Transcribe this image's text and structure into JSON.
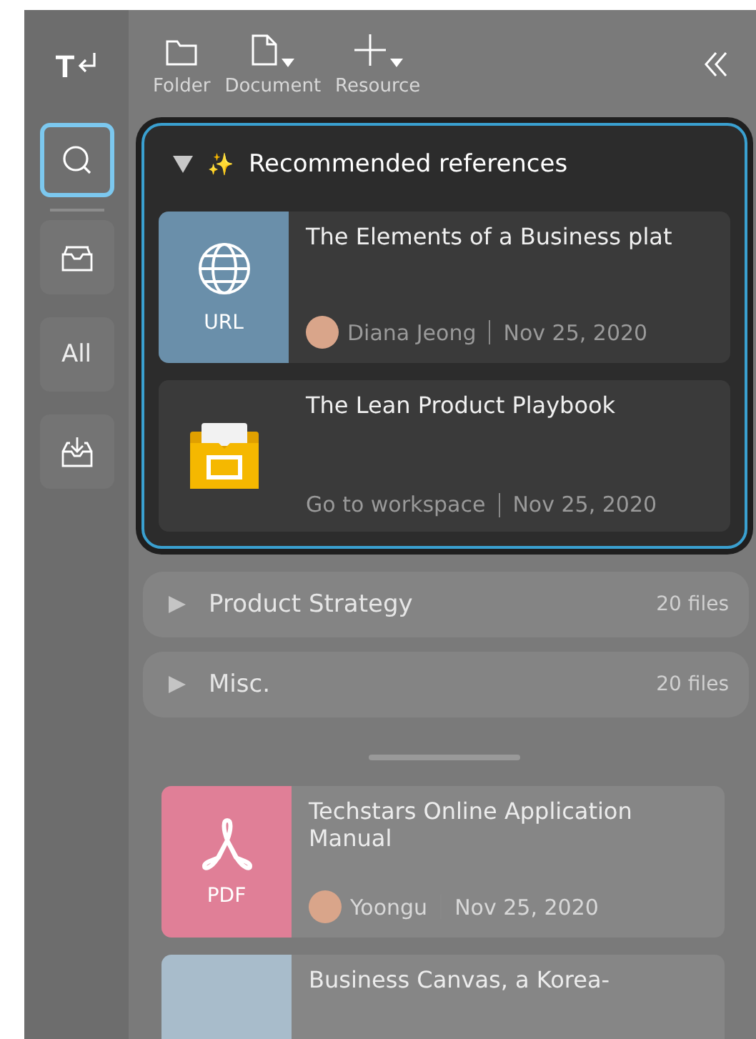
{
  "sidebar": {
    "logo": "T",
    "items": [
      {
        "kind": "search",
        "selected": true
      },
      {
        "kind": "tray",
        "selected": false
      },
      {
        "kind": "text",
        "label": "All",
        "selected": false
      },
      {
        "kind": "download",
        "selected": false
      }
    ]
  },
  "toolbar": {
    "buttons": [
      {
        "kind": "folder",
        "label": "Folder",
        "dropdown": false
      },
      {
        "kind": "document",
        "label": "Document",
        "dropdown": true
      },
      {
        "kind": "plus",
        "label": "Resource",
        "dropdown": true
      }
    ]
  },
  "recommended": {
    "expanded": true,
    "sparkle": "✨",
    "title": "Recommended references",
    "items": [
      {
        "kind": "url",
        "type_label": "URL",
        "title": "The Elements of a Business plat",
        "author": "Diana Jeong",
        "date": "Nov 25, 2020"
      },
      {
        "kind": "workspace",
        "title": "The Lean Product Playbook",
        "link": "Go to workspace",
        "date": "Nov 25, 2020"
      }
    ]
  },
  "groups": [
    {
      "name": "Product Strategy",
      "count": "20 files",
      "expanded": false
    },
    {
      "name": "Misc.",
      "count": "20 files",
      "expanded": false
    }
  ],
  "files": [
    {
      "kind": "pdf",
      "type_label": "PDF",
      "title": "Techstars Online Application Manual",
      "author": "Yoongu",
      "date": "Nov 25, 2020"
    },
    {
      "kind": "blank",
      "title": "Business Canvas, a Korea-"
    }
  ]
}
